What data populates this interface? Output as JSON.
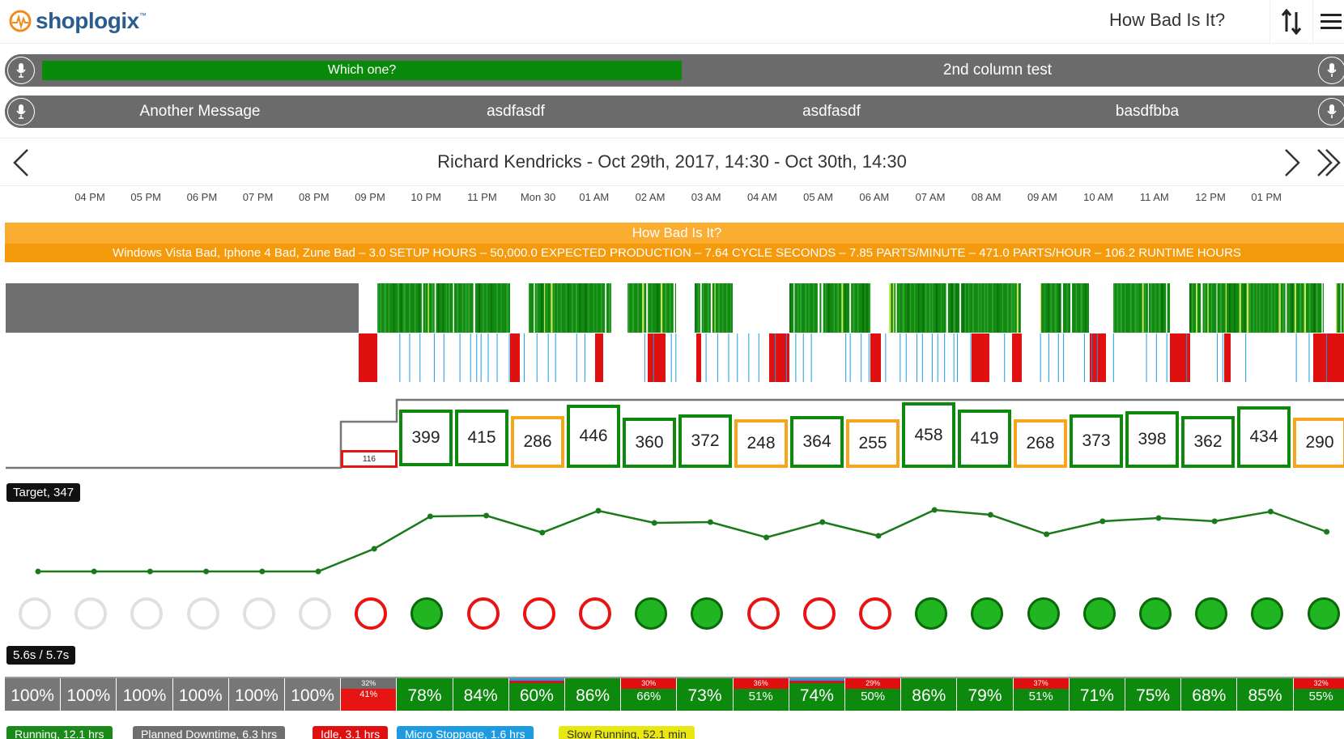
{
  "header": {
    "brand": "shoplogix",
    "title": "How Bad Is It?"
  },
  "messages": {
    "row1": [
      {
        "text": "Which one?",
        "progress": 0.5
      },
      {
        "text": "2nd column test"
      }
    ],
    "row2": [
      "Another Message",
      "asdfasdf",
      "asdfasdf",
      "basdfbba"
    ]
  },
  "nav": {
    "title": "Richard Kendricks - Oct 29th, 2017, 14:30 - Oct 30th, 14:30"
  },
  "timeline": {
    "ticks": [
      "04 PM",
      "05 PM",
      "06 PM",
      "07 PM",
      "08 PM",
      "09 PM",
      "10 PM",
      "11 PM",
      "Mon 30",
      "01 AM",
      "02 AM",
      "03 AM",
      "04 AM",
      "05 AM",
      "06 AM",
      "07 AM",
      "08 AM",
      "09 AM",
      "10 AM",
      "11 AM",
      "12 PM",
      "01 PM"
    ]
  },
  "banner": {
    "title": "How Bad Is It?",
    "details": "Windows Vista Bad, Iphone 4 Bad, Zune Bad  –  3.0 SETUP HOURS  –  50,000.0 EXPECTED PRODUCTION  –  7.64 CYCLE SECONDS  –  7.85 PARTS/MINUTE  –  471.0 PARTS/HOUR  –  106.2 RUNTIME HOURS"
  },
  "target_label": "Target, 347",
  "cycle_label": "5.6s / 5.7s",
  "hourly": [
    {
      "value": "116",
      "status": "red"
    },
    {
      "value": "399",
      "status": "green"
    },
    {
      "value": "415",
      "status": "green"
    },
    {
      "value": "286",
      "status": "orange"
    },
    {
      "value": "446",
      "status": "green"
    },
    {
      "value": "360",
      "status": "green"
    },
    {
      "value": "372",
      "status": "green"
    },
    {
      "value": "248",
      "status": "orange"
    },
    {
      "value": "364",
      "status": "green"
    },
    {
      "value": "255",
      "status": "orange"
    },
    {
      "value": "458",
      "status": "green"
    },
    {
      "value": "419",
      "status": "green"
    },
    {
      "value": "268",
      "status": "orange"
    },
    {
      "value": "373",
      "status": "green"
    },
    {
      "value": "398",
      "status": "green"
    },
    {
      "value": "362",
      "status": "green"
    },
    {
      "value": "434",
      "status": "green"
    },
    {
      "value": "290",
      "status": "orange"
    }
  ],
  "circles": [
    "empty",
    "empty",
    "empty",
    "empty",
    "empty",
    "empty",
    "red",
    "green",
    "red",
    "red",
    "red",
    "green",
    "green",
    "red",
    "red",
    "red",
    "green",
    "green",
    "green",
    "green",
    "green",
    "green",
    "green",
    "green"
  ],
  "efficiency": [
    {
      "main": "100%",
      "color": "#777"
    },
    {
      "main": "100%",
      "color": "#777"
    },
    {
      "main": "100%",
      "color": "#777"
    },
    {
      "main": "100%",
      "color": "#777"
    },
    {
      "main": "100%",
      "color": "#777"
    },
    {
      "main": "100%",
      "color": "#777"
    },
    {
      "main": "41%",
      "top": "32%",
      "color": "red"
    },
    {
      "main": "78%",
      "color": "green"
    },
    {
      "main": "84%",
      "color": "green"
    },
    {
      "main": "60%",
      "color": "green",
      "stripe": "blue"
    },
    {
      "main": "86%",
      "color": "green"
    },
    {
      "main": "66%",
      "top": "30%",
      "color": "green"
    },
    {
      "main": "73%",
      "color": "green"
    },
    {
      "main": "51%",
      "top": "36%",
      "color": "green"
    },
    {
      "main": "74%",
      "color": "green",
      "stripe": "blue"
    },
    {
      "main": "50%",
      "top": "29%",
      "color": "green"
    },
    {
      "main": "86%",
      "color": "green"
    },
    {
      "main": "79%",
      "color": "green"
    },
    {
      "main": "51%",
      "top": "37%",
      "color": "green"
    },
    {
      "main": "71%",
      "color": "green"
    },
    {
      "main": "75%",
      "color": "green"
    },
    {
      "main": "68%",
      "color": "green"
    },
    {
      "main": "85%",
      "color": "green"
    },
    {
      "main": "55%",
      "top": "32%",
      "color": "green"
    }
  ],
  "legend": [
    {
      "label": "Running, 12.1 hrs",
      "color": "#1a8a1a"
    },
    {
      "label": "Planned Downtime, 6.3 hrs",
      "color": "#6e6e6e"
    },
    {
      "label": "Idle, 3.1 hrs",
      "color": "#e01010"
    },
    {
      "label": "Micro Stoppage, 1.6 hrs",
      "color": "#1e9be0"
    },
    {
      "label": "Slow Running, 52.1 min",
      "color": "#e8e810"
    }
  ],
  "colors": {
    "green": "#0d8a0d",
    "red": "#e81414",
    "orange": "#f7a61b",
    "gray": "#6b6b6b"
  }
}
